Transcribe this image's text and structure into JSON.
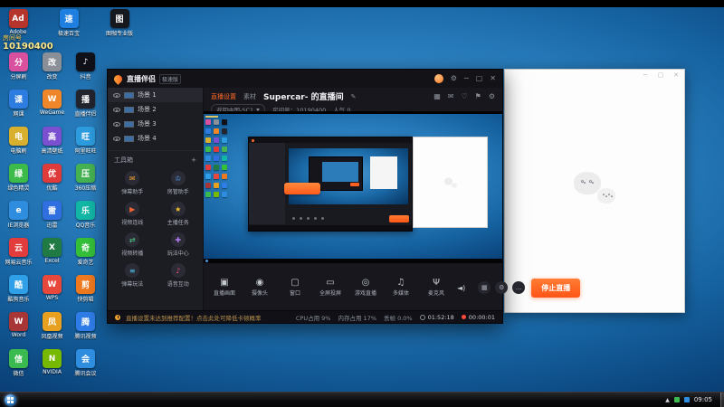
{
  "taskbar": {
    "time": "09:05"
  },
  "desktop": {
    "room_overlay": {
      "label": "房间号",
      "number": "10190400"
    },
    "top_icons": [
      {
        "label": "Adobe",
        "glyph": "Ad",
        "color": "#b5342c"
      },
      {
        "label": "极速百宝",
        "glyph": "速",
        "color": "#1f7fe0"
      },
      {
        "label": "图咖专业版",
        "glyph": "图",
        "color": "#15181d"
      }
    ],
    "icons": [
      {
        "label": "分屏刷",
        "glyph": "分",
        "color": "#d8509e"
      },
      {
        "label": "改变",
        "glyph": "改",
        "color": "#8a8f98"
      },
      {
        "label": "抖音",
        "glyph": "♪",
        "color": "#101018"
      },
      {
        "label": "网课",
        "glyph": "课",
        "color": "#2d7ce0"
      },
      {
        "label": "WeGame",
        "glyph": "W",
        "color": "#f0862a"
      },
      {
        "label": "直播伴侣",
        "glyph": "播",
        "color": "#23252e"
      },
      {
        "label": "电脑刷",
        "glyph": "电",
        "color": "#d8b02e"
      },
      {
        "label": "高清壁纸",
        "glyph": "高",
        "color": "#7a4fd0"
      },
      {
        "label": "阿里旺旺",
        "glyph": "旺",
        "color": "#2d9de0"
      },
      {
        "label": "绿色精灵",
        "glyph": "绿",
        "color": "#3dbb4a"
      },
      {
        "label": "优酷",
        "glyph": "优",
        "color": "#e03b3b"
      },
      {
        "label": "360压缩",
        "glyph": "压",
        "color": "#46b353"
      },
      {
        "label": "IE浏览器",
        "glyph": "e",
        "color": "#2f8de0"
      },
      {
        "label": "迅雷",
        "glyph": "雷",
        "color": "#2f6fe0"
      },
      {
        "label": "QQ音乐",
        "glyph": "乐",
        "color": "#12b7a6"
      },
      {
        "label": "网易云音乐",
        "glyph": "云",
        "color": "#e23c3c"
      },
      {
        "label": "Excel",
        "glyph": "X",
        "color": "#1f7a44"
      },
      {
        "label": "爱奇艺",
        "glyph": "奇",
        "color": "#35c03a"
      },
      {
        "label": "酷狗音乐",
        "glyph": "酷",
        "color": "#2fa0e8"
      },
      {
        "label": "WPS",
        "glyph": "W",
        "color": "#e8483c"
      },
      {
        "label": "快剪辑",
        "glyph": "剪",
        "color": "#f07a20"
      },
      {
        "label": "Word",
        "glyph": "W",
        "color": "#a93636"
      },
      {
        "label": "凤凰视频",
        "glyph": "凤",
        "color": "#e8a020"
      },
      {
        "label": "腾讯视频",
        "glyph": "腾",
        "color": "#2f7de8"
      },
      {
        "label": "微信",
        "glyph": "信",
        "color": "#3bba4f"
      },
      {
        "label": "NVIDIA",
        "glyph": "N",
        "color": "#76b900"
      },
      {
        "label": "腾讯会议",
        "glyph": "会",
        "color": "#2f8de0"
      }
    ]
  },
  "app": {
    "titlebar": {
      "title": "直播伴侣",
      "version_tag": "极速版",
      "window_controls": [
        "⚙",
        "─",
        "▢",
        "✕"
      ]
    },
    "header": {
      "tabs": [
        {
          "label": "直播设置",
          "active": true
        },
        {
          "label": "素材",
          "active": false
        }
      ],
      "room_title": "Supercar- 的直播间",
      "edit_icon": "✎",
      "category": "返回中国-SC1",
      "room_no": "房间号：10190400",
      "popularity": "人气 0",
      "action_icons": [
        "▦",
        "✉",
        "♡",
        "⚑",
        "⚙"
      ]
    },
    "scenes": {
      "items": [
        {
          "name": "场景 1",
          "active": true
        },
        {
          "name": "场景 2",
          "active": false
        },
        {
          "name": "场景 3",
          "active": false
        },
        {
          "name": "场景 4",
          "active": false
        }
      ]
    },
    "toolbox": {
      "title": "工具箱",
      "add_icon": "+",
      "tools": [
        {
          "label": "弹幕助手",
          "glyph": "✉",
          "color": "#f0a32f"
        },
        {
          "label": "房管助手",
          "glyph": "♔",
          "color": "#4f9df0"
        },
        {
          "label": "视频连线",
          "glyph": "▶",
          "color": "#f0632f"
        },
        {
          "label": "主播任务",
          "glyph": "★",
          "color": "#f0c22f"
        },
        {
          "label": "视频转播",
          "glyph": "⇄",
          "color": "#4fd08a"
        },
        {
          "label": "玩法中心",
          "glyph": "✚",
          "color": "#b07af0"
        },
        {
          "label": "弹幕玩法",
          "glyph": "≡",
          "color": "#4fc0f0"
        },
        {
          "label": "语音互动",
          "glyph": "♪",
          "color": "#f04f7a"
        }
      ]
    },
    "sources": {
      "items": [
        {
          "label": "直播画面",
          "glyph": "▣"
        },
        {
          "label": "摄像头",
          "glyph": "◉"
        },
        {
          "label": "窗口",
          "glyph": "▢"
        },
        {
          "label": "全屏投屏",
          "glyph": "▭"
        },
        {
          "label": "游戏直播",
          "glyph": "◎"
        },
        {
          "label": "多媒体",
          "glyph": "♫"
        },
        {
          "label": "麦克风",
          "glyph": "Ψ"
        }
      ],
      "speaker_icon": "◄)",
      "round_icons": [
        "▦",
        "⚙",
        "…"
      ],
      "stop_button": "停止直播"
    },
    "statusbar": {
      "tip": "直播设置未达到推荐配置！点击此处可降低卡顿概率",
      "cpu": "CPU占用 9%",
      "memory": "内存占用 17%",
      "dropped": "丢帧 0.0%",
      "duration": "01:52:18",
      "record_time": "00:00:01"
    }
  },
  "white_window": {
    "controls": [
      "─",
      "▢",
      "✕"
    ]
  }
}
